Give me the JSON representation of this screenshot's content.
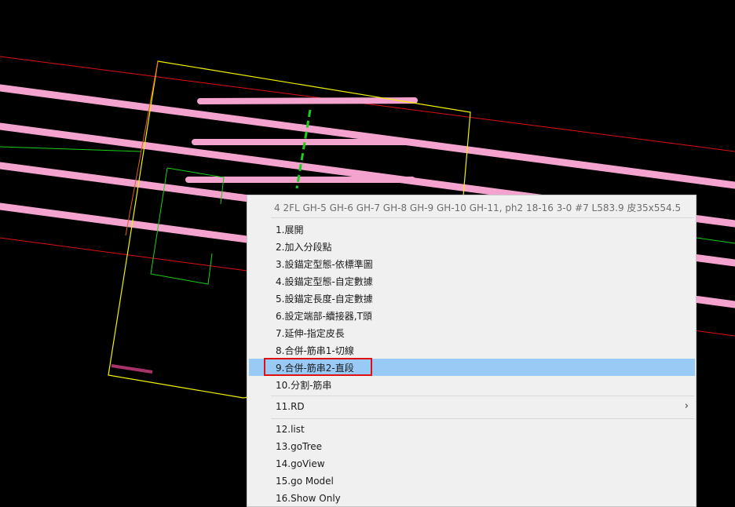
{
  "context_menu": {
    "header": "4 2FL GH-5 GH-6 GH-7 GH-8 GH-9 GH-10 GH-11, ph2 18-16 3-0 #7 L583.9 皮35x554.5",
    "items": [
      {
        "label": "1.展開"
      },
      {
        "label": "2.加入分段點"
      },
      {
        "label": "3.設錨定型態-依標準圖"
      },
      {
        "label": "4.設錨定型態-自定數據"
      },
      {
        "label": "5.設錨定長度-自定數據"
      },
      {
        "label": "6.設定端部-續接器,T頭"
      },
      {
        "label": "7.延伸-指定皮長"
      },
      {
        "label": "8.合併-筋串1-切線"
      },
      {
        "label": "9.合併-筋串2-直段",
        "highlighted": true
      },
      {
        "label": "10.分割-筋串"
      },
      {
        "label": "11.RD",
        "submenu": true
      },
      {
        "label": "12.list"
      },
      {
        "label": "13.goTree"
      },
      {
        "label": "14.goView"
      },
      {
        "label": "15.go Model"
      },
      {
        "label": "16.Show Only"
      }
    ],
    "submenu_arrow": "›"
  },
  "colors": {
    "background": "#000000",
    "rebar": "#f4a3cf",
    "boundary_red": "#e01010",
    "selection_yellow": "#f2f200",
    "outline_green": "#19d019",
    "menu_bg": "#f0f0f0",
    "menu_highlight": "#99c9f5",
    "callout_red": "#e01010"
  }
}
